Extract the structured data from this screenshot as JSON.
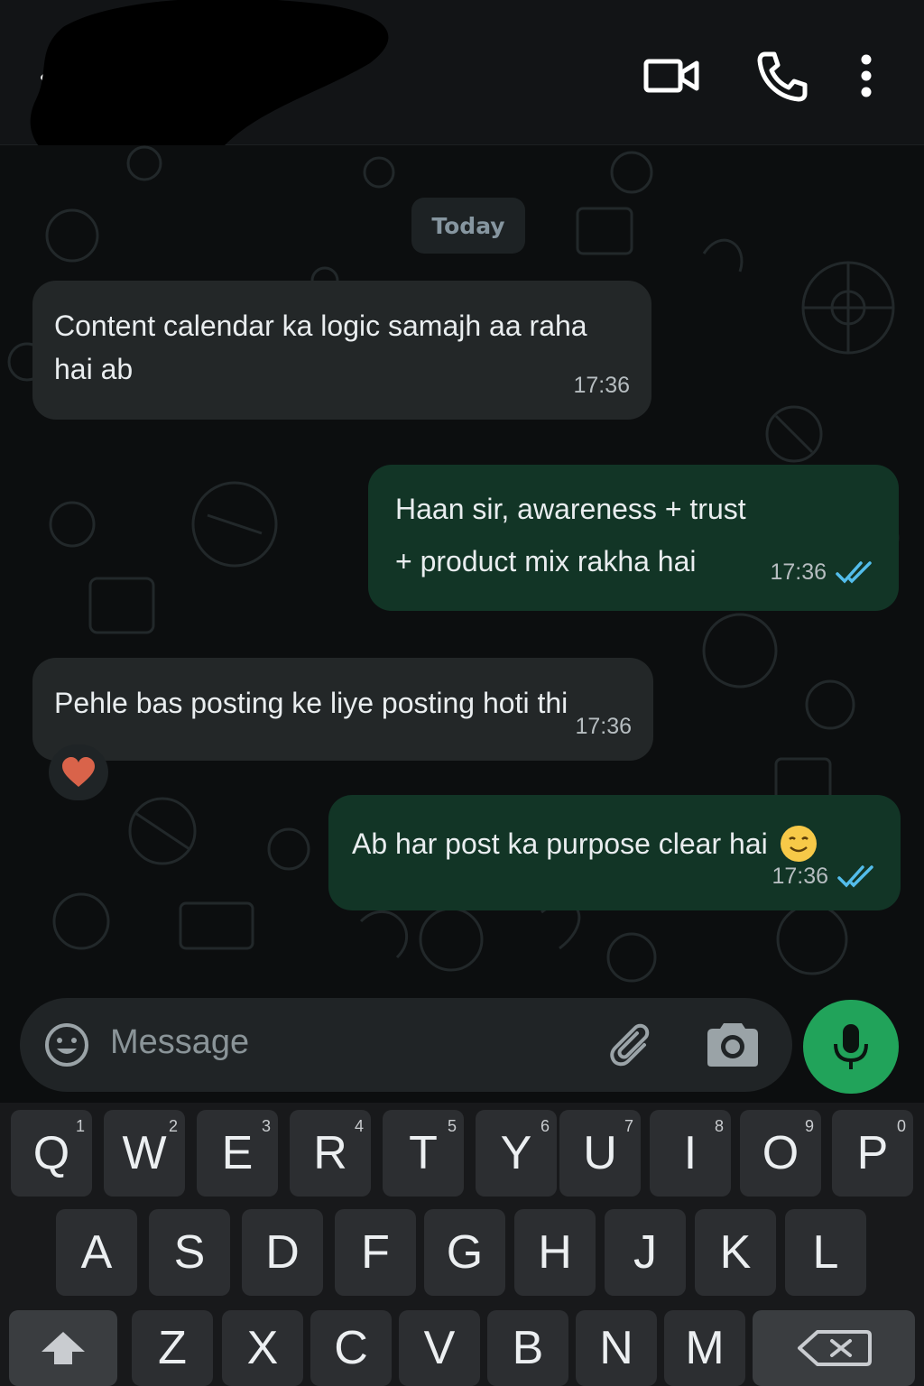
{
  "header": {
    "back_icon": "chevron-left-icon",
    "actions": [
      {
        "name": "video-call-icon"
      },
      {
        "name": "phone-icon"
      },
      {
        "name": "more-vertical-icon"
      }
    ]
  },
  "chat": {
    "date_separator": "Today",
    "messages": [
      {
        "direction": "in",
        "text": "Content calendar ka logic samajh aa raha hai ab",
        "line1": "Content calendar ka logic samajh aa raha",
        "line2": "hai ab",
        "time": "17:36"
      },
      {
        "direction": "out",
        "line1": "Haan sir, awareness + trust",
        "line2": "+ product mix rakha hai",
        "time": "17:36",
        "status": "read"
      },
      {
        "direction": "in",
        "text": "Pehle bas posting ke liye posting hoti thi",
        "time": "17:36",
        "reaction": "❤"
      },
      {
        "direction": "out",
        "text": "Ab har post ka purpose clear hai",
        "emoji": "smiling-face-icon",
        "time": "17:36",
        "status": "read"
      }
    ]
  },
  "composer": {
    "placeholder": "Message",
    "icons": [
      "emoji-icon",
      "paperclip-icon",
      "camera-icon",
      "microphone-icon"
    ]
  },
  "keyboard": {
    "row1": [
      {
        "k": "Q",
        "h": "1"
      },
      {
        "k": "W",
        "h": "2"
      },
      {
        "k": "E",
        "h": "3"
      },
      {
        "k": "R",
        "h": "4"
      },
      {
        "k": "T",
        "h": "5"
      },
      {
        "k": "Y",
        "h": "6"
      },
      {
        "k": "U",
        "h": "7"
      },
      {
        "k": "I",
        "h": "8"
      },
      {
        "k": "O",
        "h": "9"
      },
      {
        "k": "P",
        "h": "0"
      }
    ],
    "row2": [
      "A",
      "S",
      "D",
      "F",
      "G",
      "H",
      "J",
      "K",
      "L"
    ],
    "row3": [
      "Z",
      "X",
      "C",
      "V",
      "B",
      "N",
      "M"
    ]
  },
  "colors": {
    "incoming_bubble": "#232728",
    "outgoing_bubble": "#123526",
    "accent_green": "#21a35a",
    "read_tick": "#53bdeb"
  }
}
